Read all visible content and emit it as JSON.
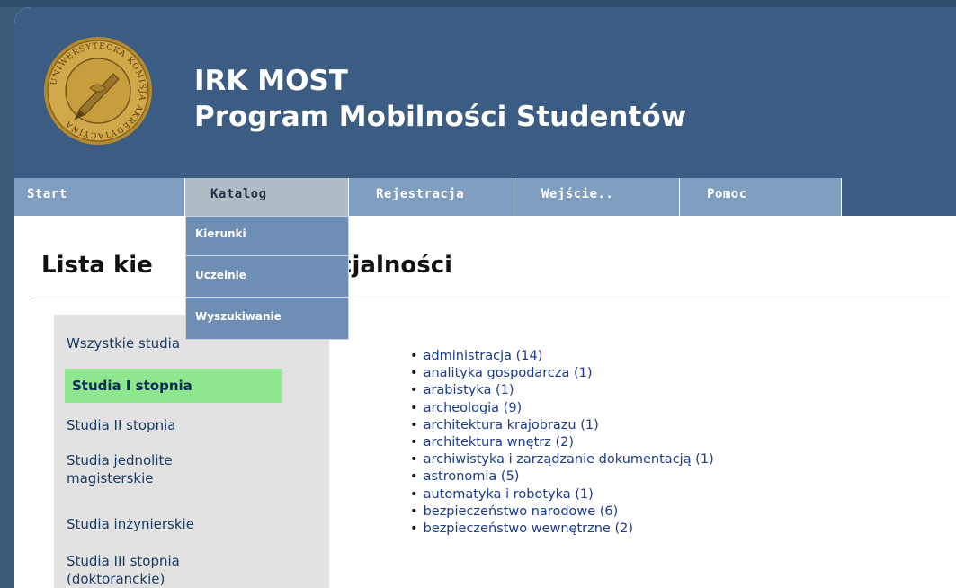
{
  "header": {
    "title_line1": "IRK MOST",
    "title_line2": "Program Mobilności Studentów",
    "seal_text": "UNIWERSYTECKA KOMISJA AKREDYTACYJNA"
  },
  "nav": {
    "tabs": [
      {
        "label": "Start"
      },
      {
        "label": "Katalog",
        "active": true
      },
      {
        "label": "Rejestracja"
      },
      {
        "label": "Wejście.."
      },
      {
        "label": "Pomoc"
      }
    ],
    "dropdown": [
      "Kierunki",
      "Uczelnie",
      "Wyszukiwanie"
    ]
  },
  "page": {
    "heading_left": "Lista kie",
    "heading_right": "pecjalności"
  },
  "sidebar": {
    "items": [
      {
        "label": "Wszystkie studia"
      },
      {
        "label": "Studia I stopnia",
        "active": true
      },
      {
        "label": "Studia II stopnia"
      },
      {
        "label": "Studia jednolite magisterskie"
      },
      {
        "label": "Studia inżynierskie"
      },
      {
        "label": "Studia III stopnia (doktoranckie)"
      }
    ]
  },
  "majors": [
    "administracja (14)",
    "analityka gospodarcza (1)",
    "arabistyka (1)",
    "archeologia (9)",
    "architektura krajobrazu (1)",
    "architektura wnętrz (2)",
    "archiwistyka i zarządzanie dokumentacją (1)",
    "astronomia (5)",
    "automatyka i robotyka (1)",
    "bezpieczeństwo narodowe (6)",
    "bezpieczeństwo wewnętrzne (2)"
  ],
  "colors": {
    "header_bg": "#3b5d83",
    "nav_bg": "#7f9ec0",
    "active_tab_bg": "#b2bcc4",
    "active_sidebar_bg": "#8ee68e",
    "link_color": "#1b3b8a"
  }
}
